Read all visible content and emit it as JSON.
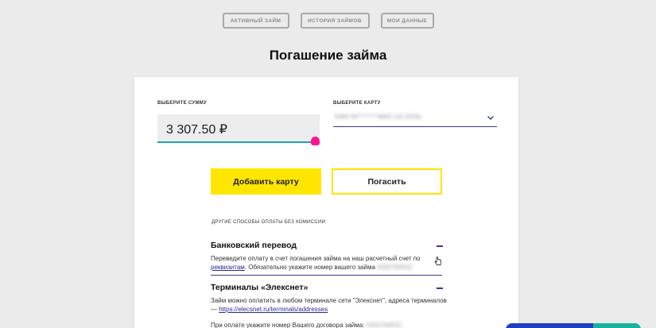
{
  "tabs": [
    "активный займ",
    "история займов",
    "мои данные"
  ],
  "page_title": "Погашение займа",
  "amount": {
    "label": "выберите сумму",
    "value": "3 307.50 ₽",
    "slider_fraction": 1.0
  },
  "card_select": {
    "label": "выберите карту",
    "value": "5469 50********8842 (10.2026)"
  },
  "buttons": {
    "add_card": "Добавить карту",
    "pay": "Погасить"
  },
  "other_methods": {
    "title": "другие способы оплаты без комиссии:",
    "bank": {
      "heading": "Банковский перевод",
      "text_1": "Переведите оплату в счет погашения займа на наш расчетный счет по",
      "link": "реквизитам",
      "text_2": ". Обязательно укажите номер вашего займа",
      "loan_number": "0000784932"
    },
    "terminals": {
      "heading": "Терминалы «Элекснет»",
      "text_1": "Займ можно оплатить в любом терминале сети \"Элекснет\", адреса терминалов —",
      "link": "https://elecsnet.ru/terminals/addresses",
      "text_2": "При оплате укажите номер Вашего договора займа:",
      "contract_number": "0000784932"
    }
  },
  "colors": {
    "accent_yellow": "#ffe600",
    "slider_teal": "#1aa3ad",
    "slider_handle": "#ff1493",
    "navy_line": "#3a3a8c"
  }
}
